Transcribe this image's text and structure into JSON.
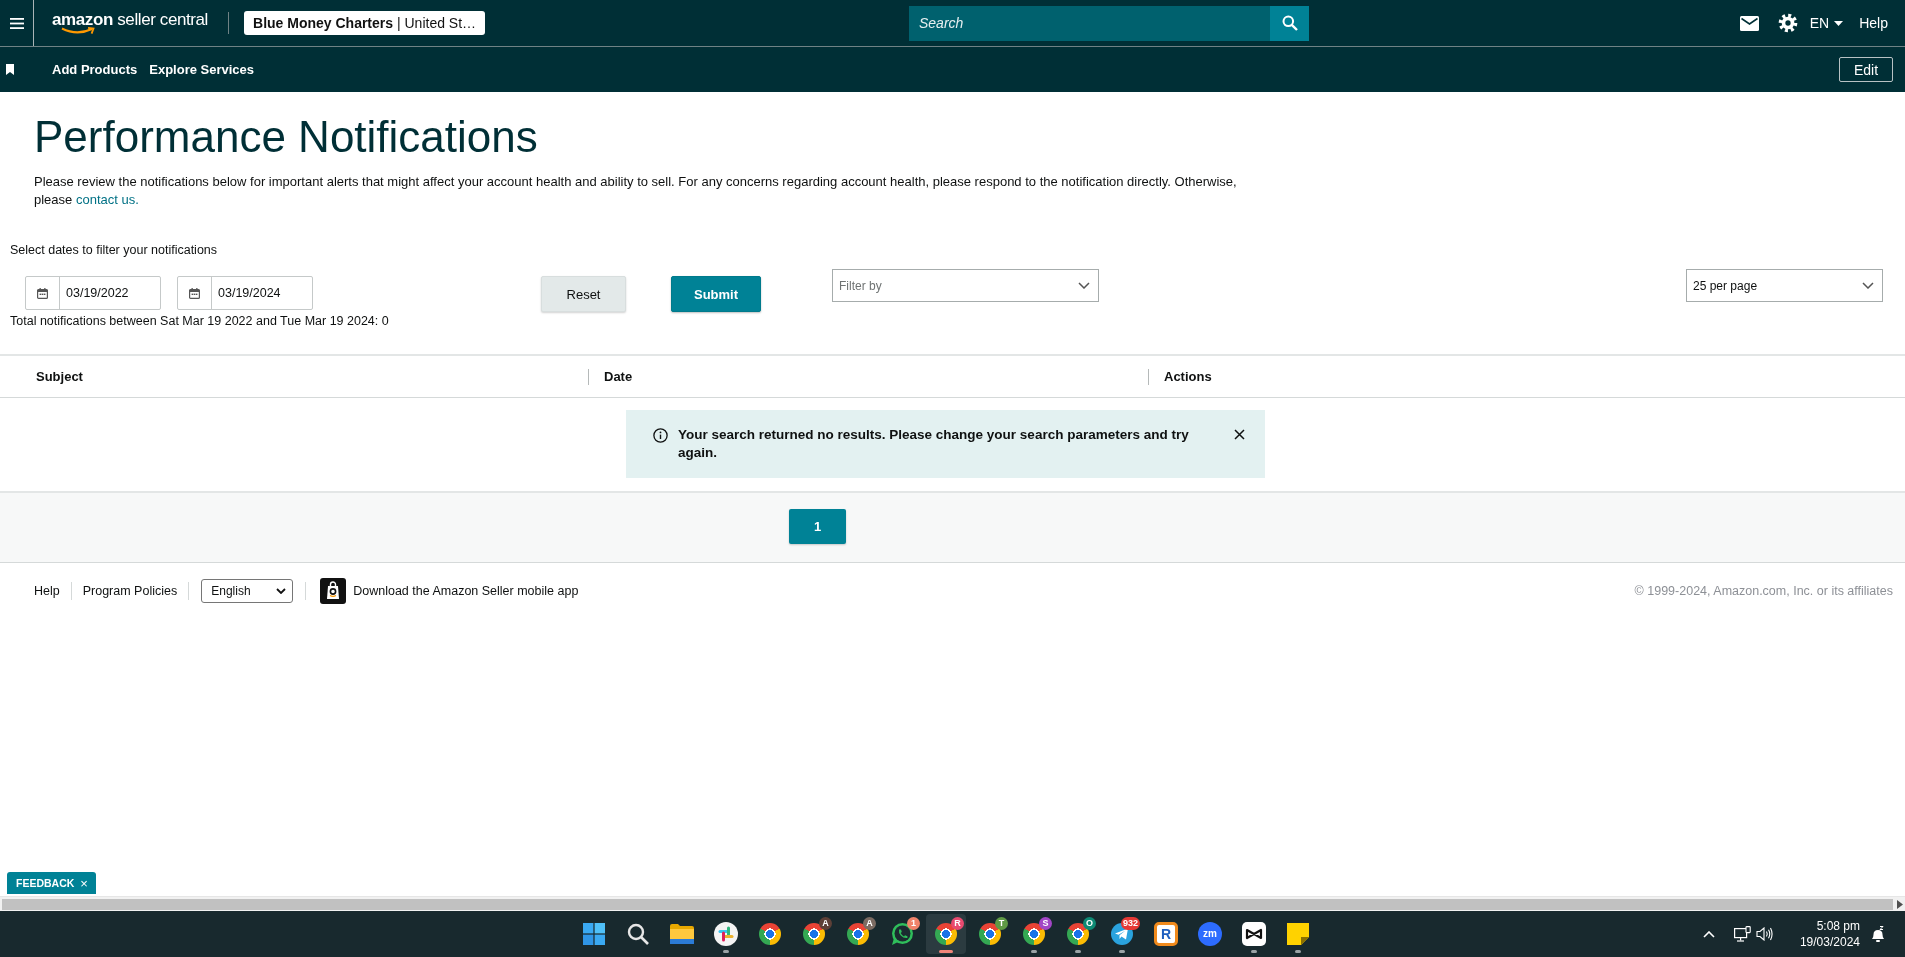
{
  "top_bar": {
    "logo": "**amazon** seller central",
    "account": "**Blue Money Charters** | United St…",
    "search": {
      "placeholder": "Search"
    },
    "language": "EN",
    "help": "Help"
  },
  "nav_bar": {
    "links": [
      "Add Products",
      "Explore Services"
    ],
    "edit": "Edit"
  },
  "page": {
    "title": "Performance Notifications",
    "intro": "Please review the notifications below for important alerts that might affect your account health and ability to sell. For any concerns regarding account health, please respond to the notification directly. Otherwise, please",
    "contact_link": "contact us."
  },
  "filters": {
    "label": "Select dates to filter your notifications",
    "dates": [
      "03/19/2022",
      "03/19/2024"
    ],
    "buttons": [
      {
        "label": "Reset",
        "kind": "secondary"
      },
      {
        "label": "Submit",
        "kind": "primary"
      }
    ],
    "filter_by": {
      "placeholder": "Filter by"
    },
    "page_size": "25 per page",
    "total": "Total notifications between Sat Mar 19 2022 and Tue Mar 19 2024: 0"
  },
  "table": {
    "columns": [
      "Subject",
      "Date",
      "Actions"
    ],
    "alert": {
      "message": "Your search returned no results. Please change your search parameters and try again."
    }
  },
  "pagination": {
    "pages": [
      {
        "label": "1",
        "selected": true
      }
    ]
  },
  "footer": {
    "links": [
      "Help",
      "Program Policies"
    ],
    "language": "English",
    "app_link": "Download the Amazon Seller mobile app",
    "copyright": "© 1999-2024, Amazon.com, Inc. or its affiliates"
  },
  "feedback": {
    "label": "FEEDBACK",
    "close": "×"
  },
  "taskbar": {
    "apps": [
      {
        "kind": "start",
        "running": false,
        "selected": false
      },
      {
        "kind": "search",
        "running": false,
        "selected": false
      },
      {
        "kind": "folder",
        "running": false,
        "selected": false
      },
      {
        "kind": "slack",
        "running": true,
        "selected": false
      },
      {
        "kind": "browser",
        "running": false,
        "selected": false
      },
      {
        "kind": "browser",
        "badge": {
          "text": "A",
          "color": "#5d4037"
        },
        "running": false,
        "selected": false
      },
      {
        "kind": "browser",
        "badge": {
          "text": "A",
          "color": "#7b6b62"
        },
        "running": false,
        "selected": false
      },
      {
        "kind": "chat",
        "badge": {
          "text": "1",
          "color": "#f0836a"
        },
        "running": false,
        "selected": false
      },
      {
        "kind": "browser",
        "badge": {
          "text": "R",
          "color": "#e84a6f"
        },
        "running": true,
        "selected": true
      },
      {
        "kind": "browser",
        "badge": {
          "text": "T",
          "color": "#5f9a45"
        },
        "running": false,
        "selected": false
      },
      {
        "kind": "browser",
        "badge": {
          "text": "S",
          "color": "#a246c6"
        },
        "running": true,
        "selected": false
      },
      {
        "kind": "browser",
        "badge": {
          "text": "O",
          "color": "#0e8a74"
        },
        "running": true,
        "selected": false
      },
      {
        "kind": "messenger",
        "badge": {
          "text": "932",
          "color": "#e53935"
        },
        "running": true,
        "selected": false
      },
      {
        "kind": "letter_tile",
        "glyph": "R",
        "running": false,
        "selected": false
      },
      {
        "kind": "video",
        "glyph": "zm",
        "running": false,
        "selected": false
      },
      {
        "kind": "editor",
        "running": true,
        "selected": false
      },
      {
        "kind": "notes",
        "running": true,
        "selected": false
      }
    ],
    "clock": {
      "time": "5:08 pm",
      "date": "19/03/2024"
    }
  }
}
